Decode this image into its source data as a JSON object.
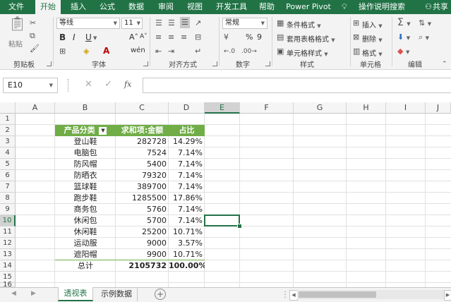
{
  "ribbon_tabs": [
    {
      "label": "文件",
      "active": false
    },
    {
      "label": "开始",
      "active": true
    },
    {
      "label": "插入",
      "active": false
    },
    {
      "label": "公式",
      "active": false
    },
    {
      "label": "数据",
      "active": false
    },
    {
      "label": "审阅",
      "active": false
    },
    {
      "label": "视图",
      "active": false
    },
    {
      "label": "开发工具",
      "active": false
    },
    {
      "label": "帮助",
      "active": false
    },
    {
      "label": "Power Pivot",
      "active": false
    },
    {
      "label": "操作说明搜索",
      "active": false
    },
    {
      "label": "共享",
      "active": false
    }
  ],
  "ribbon": {
    "clipboard": {
      "label": "剪贴板",
      "paste": "粘贴"
    },
    "font": {
      "label": "字体",
      "name": "等线",
      "size": "11",
      "bold": "B",
      "italic": "I",
      "underline": "U",
      "grow": "A˄",
      "shrink": "A˅",
      "wen": "wén"
    },
    "align": {
      "label": "对齐方式"
    },
    "number": {
      "label": "数字",
      "format": "常规",
      "percent": "%",
      "comma": "9"
    },
    "styles": {
      "label": "样式",
      "conditional": "条件格式",
      "table": "套用表格格式",
      "cell_styles": "单元格样式"
    },
    "cells": {
      "label": "单元格",
      "insert": "插入",
      "delete": "删除",
      "format": "格式"
    },
    "editing": {
      "label": "编辑"
    }
  },
  "formula_bar": {
    "name_box": "E10",
    "fx": "fx",
    "value": ""
  },
  "columns": [
    "A",
    "B",
    "C",
    "D",
    "E",
    "F",
    "G",
    "H",
    "I",
    "J"
  ],
  "rows": [
    "1",
    "2",
    "3",
    "4",
    "5",
    "6",
    "7",
    "8",
    "9",
    "10",
    "11",
    "12",
    "13",
    "14",
    "15",
    "16"
  ],
  "pivot": {
    "headers": [
      "产品分类",
      "求和项:金额",
      "占比"
    ],
    "rows": [
      {
        "cat": "登山鞋",
        "amount": "282728",
        "pct": "14.29%"
      },
      {
        "cat": "电脑包",
        "amount": "7524",
        "pct": "7.14%"
      },
      {
        "cat": "防风帽",
        "amount": "5400",
        "pct": "7.14%"
      },
      {
        "cat": "防晒衣",
        "amount": "79320",
        "pct": "7.14%"
      },
      {
        "cat": "篮球鞋",
        "amount": "389700",
        "pct": "7.14%"
      },
      {
        "cat": "跑步鞋",
        "amount": "1285500",
        "pct": "17.86%"
      },
      {
        "cat": "商务包",
        "amount": "5760",
        "pct": "7.14%"
      },
      {
        "cat": "休闲包",
        "amount": "5700",
        "pct": "7.14%"
      },
      {
        "cat": "休闲鞋",
        "amount": "25200",
        "pct": "10.71%"
      },
      {
        "cat": "运动服",
        "amount": "9000",
        "pct": "3.57%"
      },
      {
        "cat": "遮阳帽",
        "amount": "9900",
        "pct": "10.71%"
      }
    ],
    "total": {
      "cat": "总计",
      "amount": "2105732",
      "pct": "100.00%"
    },
    "header_color": "#70ad47"
  },
  "sheet_tabs": [
    {
      "label": "透视表",
      "active": true
    },
    {
      "label": "示例数据",
      "active": false
    }
  ],
  "colors": {
    "accent": "#217346",
    "header_green": "#70ad47"
  }
}
